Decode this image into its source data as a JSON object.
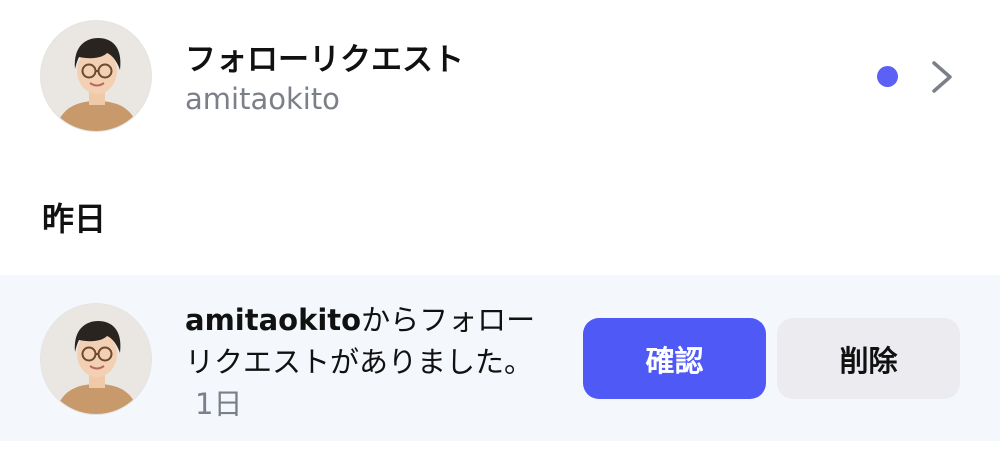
{
  "follow_requests": {
    "title": "フォローリクエスト",
    "username": "amitaokito",
    "unread": true,
    "icons": [
      "avatar",
      "unread-dot-icon",
      "chevron-right-icon"
    ]
  },
  "sections": [
    {
      "heading": "昨日",
      "notifications": [
        {
          "username": "amitaokito",
          "message": "からフォローリクエストがありました。",
          "time": "1日",
          "confirm_label": "確認",
          "delete_label": "削除"
        }
      ]
    }
  ],
  "colors": {
    "accent": "#4f59f5",
    "unread_dot": "#5b61f4",
    "highlight_bg": "#f4f8fd",
    "secondary_button_bg": "#ececf0",
    "muted_text": "#7b7f87"
  }
}
